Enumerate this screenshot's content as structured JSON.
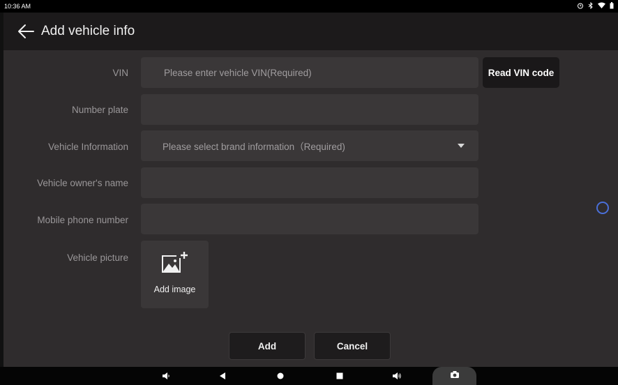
{
  "status_bar": {
    "time": "10:36 AM",
    "icons": [
      "alarm-icon",
      "bluetooth-icon",
      "wifi-icon",
      "battery-icon"
    ]
  },
  "header": {
    "title": "Add vehicle info",
    "back_icon": "arrow-left-icon"
  },
  "form": {
    "vin": {
      "label": "VIN",
      "placeholder": "Please enter vehicle VIN(Required)",
      "value": ""
    },
    "read_vin_button": "Read VIN code",
    "number_plate": {
      "label": "Number plate",
      "value": ""
    },
    "vehicle_information": {
      "label": "Vehicle Information",
      "placeholder": "Please select brand information（Required)"
    },
    "owner_name": {
      "label": "Vehicle owner's name",
      "value": ""
    },
    "mobile_phone": {
      "label": "Mobile phone number",
      "value": ""
    },
    "vehicle_picture": {
      "label": "Vehicle picture",
      "add_image_label": "Add image"
    }
  },
  "actions": {
    "add_label": "Add",
    "cancel_label": "Cancel"
  },
  "colors": {
    "background": "#2f2c2d",
    "header": "#1c1a1b",
    "field": "#3a3738",
    "accent": "#4a6fd8"
  },
  "nav_bar": [
    "volume-down-icon",
    "back-icon",
    "home-icon",
    "recents-icon",
    "volume-up-icon",
    "camera-icon"
  ]
}
